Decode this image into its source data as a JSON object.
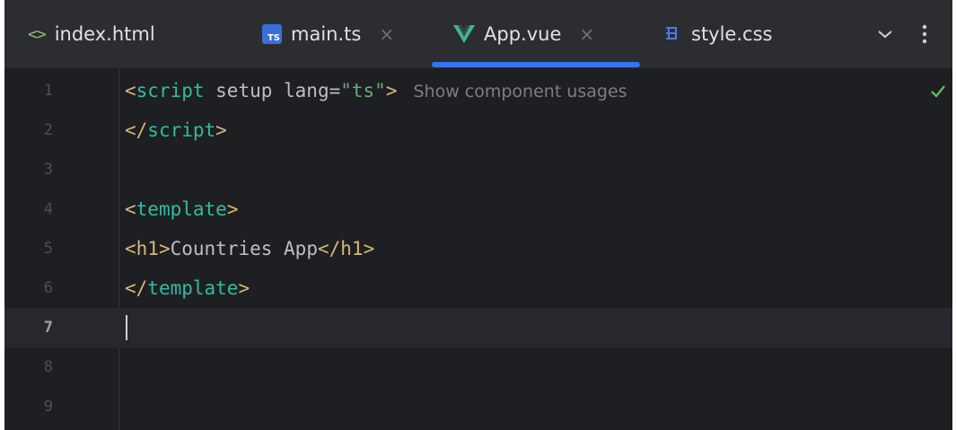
{
  "tabs": [
    {
      "label": "index.html",
      "icon": "html-file-icon",
      "active": false
    },
    {
      "label": "main.ts",
      "icon": "typescript-file-icon",
      "active": false,
      "close": "×",
      "badge": "TS"
    },
    {
      "label": "App.vue",
      "icon": "vue-file-icon",
      "active": true,
      "close": "×"
    },
    {
      "label": "style.css",
      "icon": "css-file-icon",
      "active": false
    }
  ],
  "tab_tools": {
    "chevron": "⌄",
    "more": "⋮"
  },
  "editor": {
    "current_line": 7,
    "lines": [
      {
        "num": "1",
        "parts": [
          "<",
          "script",
          " setup lang=",
          "\"ts\"",
          ">"
        ],
        "hint": "Show component usages"
      },
      {
        "num": "2",
        "parts": [
          "</",
          "script",
          ">"
        ]
      },
      {
        "num": "3",
        "parts": []
      },
      {
        "num": "4",
        "parts": [
          "<",
          "template",
          ">"
        ]
      },
      {
        "num": "5",
        "parts": [
          "<",
          "h1",
          ">",
          "Countries App",
          "</",
          "h1",
          ">"
        ]
      },
      {
        "num": "6",
        "parts": [
          "</",
          "template",
          ">"
        ]
      },
      {
        "num": "7",
        "parts": []
      },
      {
        "num": "8",
        "parts": []
      },
      {
        "num": "9",
        "parts": []
      }
    ],
    "status": "no-problems-check-icon"
  },
  "colors": {
    "accent": "#3574f0",
    "tag": "#2fbca1",
    "punctuation": "#d5b778",
    "string": "#6aab73",
    "check": "#5fb865"
  }
}
